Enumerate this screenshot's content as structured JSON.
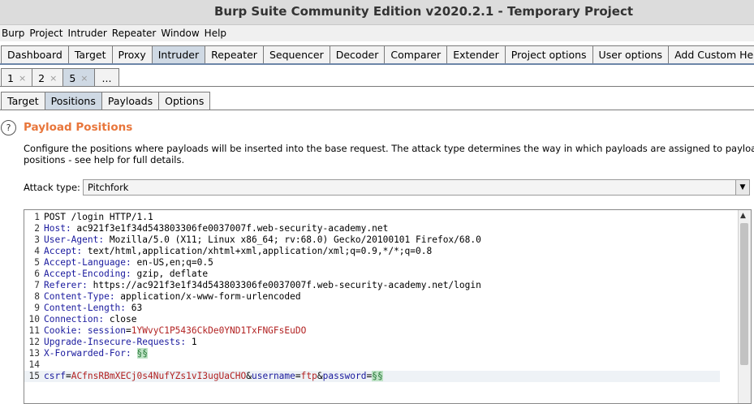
{
  "window": {
    "title": "Burp Suite Community Edition v2020.2.1 - Temporary Project"
  },
  "menu": [
    "Burp",
    "Project",
    "Intruder",
    "Repeater",
    "Window",
    "Help"
  ],
  "main_tabs": [
    "Dashboard",
    "Target",
    "Proxy",
    "Intruder",
    "Repeater",
    "Sequencer",
    "Decoder",
    "Comparer",
    "Extender",
    "Project options",
    "User options",
    "Add Custom Header"
  ],
  "main_tabs_active": "Intruder",
  "attack_tabs": [
    "1",
    "2",
    "5"
  ],
  "attack_tab_close": "×",
  "attack_tabs_more": "...",
  "attack_tabs_active": "5",
  "sub_tabs": [
    "Target",
    "Positions",
    "Payloads",
    "Options"
  ],
  "sub_tabs_active": "Positions",
  "positions": {
    "help_icon": "?",
    "heading": "Payload Positions",
    "description_line1": "Configure the positions where payloads will be inserted into the base request. The attack type determines the way in which payloads are assigned to payload",
    "description_line2": "positions - see help for full details.",
    "attack_type_label": "Attack type:",
    "attack_type_value": "Pitchfork"
  },
  "request": {
    "line1": "POST /login HTTP/1.1",
    "host_key": "Host:",
    "host_val": " ac921f3e1f34d543803306fe0037007f.web-security-academy.net",
    "ua_key": "User-Agent:",
    "ua_val": " Mozilla/5.0 (X11; Linux x86_64; rv:68.0) Gecko/20100101 Firefox/68.0",
    "accept_key": "Accept:",
    "accept_val": " text/html,application/xhtml+xml,application/xml;q=0.9,*/*;q=0.8",
    "al_key": "Accept-Language:",
    "al_val": " en-US,en;q=0.5",
    "ae_key": "Accept-Encoding:",
    "ae_val": " gzip, deflate",
    "ref_key": "Referer:",
    "ref_val": " https://ac921f3e1f34d543803306fe0037007f.web-security-academy.net/login",
    "ct_key": "Content-Type:",
    "ct_val": " application/x-www-form-urlencoded",
    "cl_key": "Content-Length:",
    "cl_val": " 63",
    "conn_key": "Connection:",
    "conn_val": " close",
    "cookie_key": "Cookie:",
    "cookie_name": " session",
    "cookie_eq": "=",
    "cookie_val": "1YWvyC1P5436CkDe0YND1TxFNGFsEuDO",
    "uir_key": "Upgrade-Insecure-Requests:",
    "uir_val": " 1",
    "xff_key": "X-Forwarded-For:",
    "xff_marker": "§§",
    "body_csrf_k": "csrf",
    "body_csrf_v": "ACfnsRBmXECj0s4NufYZs1vI3ugUaCHO",
    "body_amp": "&",
    "body_eq": "=",
    "body_user_k": "username",
    "body_user_v": "ftp",
    "body_pass_k": "password",
    "body_pass_marker": "§§"
  }
}
